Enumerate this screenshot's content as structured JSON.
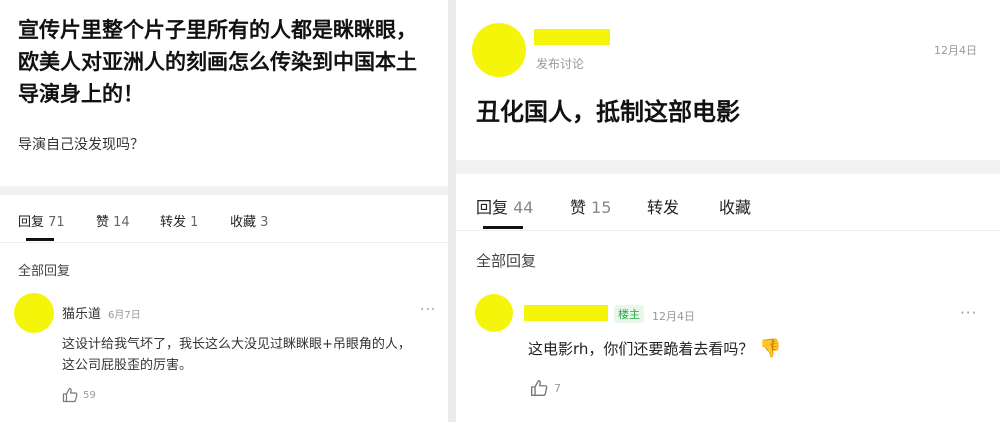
{
  "left": {
    "post_title": "宣传片里整个片子里所有的人都是眯眯眼，欧美人对亚洲人的刻画怎么传染到中国本土导演身上的！",
    "post_body": "导演自己没发现吗？",
    "tabs": {
      "reply_label": "回复",
      "reply_count": "71",
      "like_label": "赞",
      "like_count": "14",
      "repost_label": "转发",
      "repost_count": "1",
      "fav_label": "收藏",
      "fav_count": "3"
    },
    "all_replies": "全部回复",
    "comment": {
      "username": "猫乐道",
      "date": "6月7日",
      "text": "这设计给我气坏了，我长这么大没见过眯眯眼+吊眼角的人，这公司屁股歪的厉害。",
      "likes": "59"
    },
    "more": "···"
  },
  "right": {
    "post_meta": "发布讨论",
    "post_date": "12月4日",
    "post_title": "丑化国人，抵制这部电影",
    "tabs": {
      "reply_label": "回复",
      "reply_count": "44",
      "like_label": "赞",
      "like_count": "15",
      "repost_label": "转发",
      "fav_label": "收藏"
    },
    "all_replies": "全部回复",
    "comment": {
      "badge": "楼主",
      "date": "12月4日",
      "text": "这电影rh，你们还要跪着去看吗？",
      "emoji": "👎",
      "likes": "7"
    },
    "more": "···"
  },
  "colors": {
    "redaction": "#f5f50a",
    "badge_green": "#2aa84a"
  }
}
